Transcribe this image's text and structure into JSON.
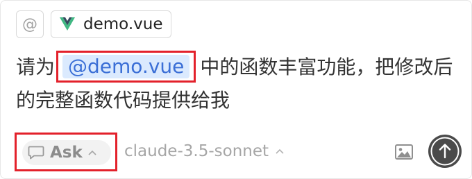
{
  "context": {
    "at_symbol": "@",
    "file_chip_label": "demo.vue"
  },
  "message": {
    "before": "请为",
    "mention": "@demo.vue",
    "after": "中的函数丰富功能，把修改后的完整函数代码提供给我"
  },
  "toolbar": {
    "mode_label": "Ask",
    "model_label": "claude-3.5-sonnet"
  },
  "colors": {
    "highlight_border": "#e3212b",
    "mention_bg": "#dbeafe",
    "mention_text": "#3b6fd6",
    "vue_green": "#41b883",
    "vue_dark": "#35495e",
    "send_button": "#4a4a4a"
  },
  "icons": {
    "file_chip": "vue-icon",
    "mode": "chat-bubble-icon",
    "mode_chevron": "chevron-up-icon",
    "model_chevron": "chevron-up-icon",
    "image": "image-icon",
    "send": "arrow-up-icon"
  }
}
